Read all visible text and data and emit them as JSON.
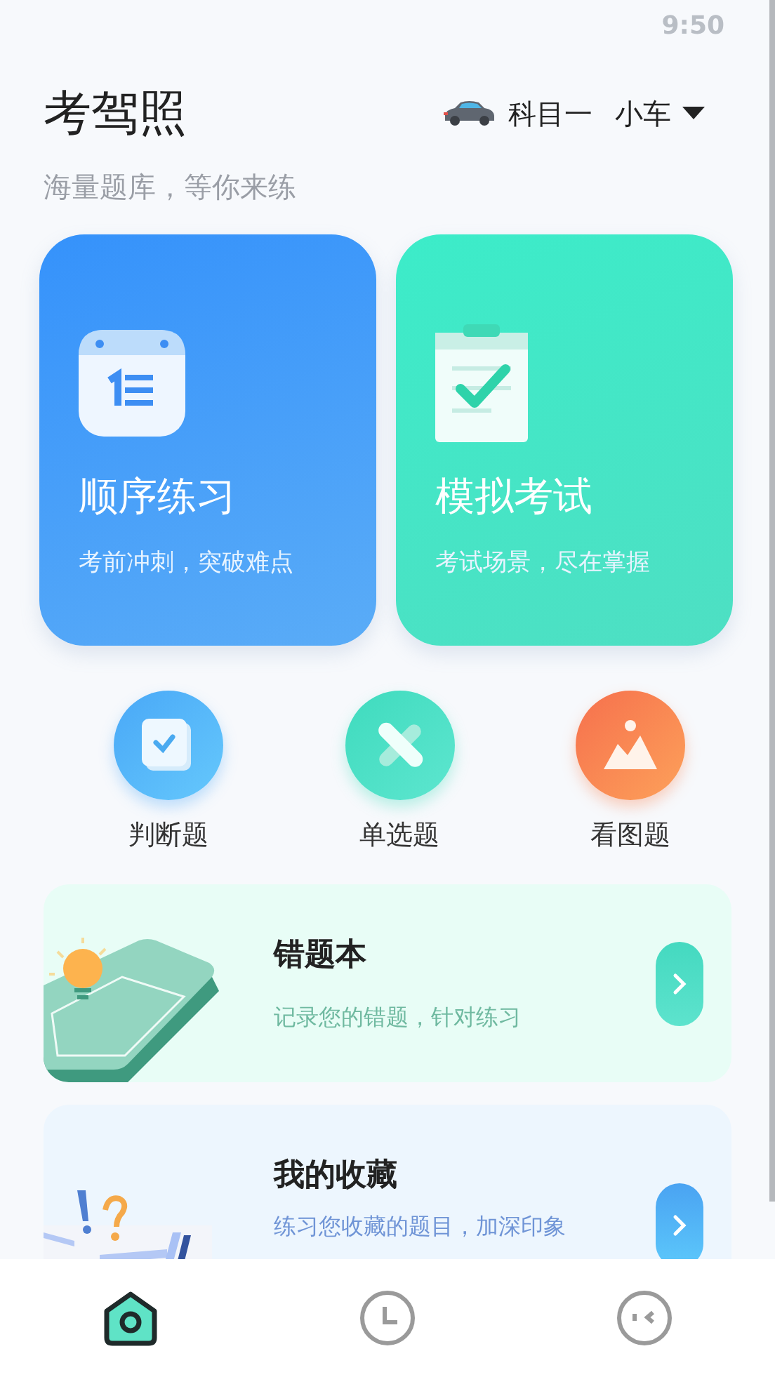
{
  "status_bar": {
    "time": "9:50"
  },
  "header": {
    "title": "考驾照",
    "subtitle": "海量题库，等你来练",
    "subject": "科目一",
    "vehicle": "小车"
  },
  "feature_cards": [
    {
      "kind": "sequential",
      "title": "顺序练习",
      "subtitle": "考前冲刺，突破难点"
    },
    {
      "kind": "mock_exam",
      "title": "模拟考试",
      "subtitle": "考试场景，尽在掌握"
    }
  ],
  "categories": [
    {
      "kind": "true_false",
      "label": "判断题"
    },
    {
      "kind": "single_choice",
      "label": "单选题"
    },
    {
      "kind": "image",
      "label": "看图题"
    }
  ],
  "list_cards": [
    {
      "kind": "mistakes",
      "title": "错题本",
      "subtitle": "记录您的错题，针对练习"
    },
    {
      "kind": "favorites",
      "title": "我的收藏",
      "subtitle": "练习您收藏的题目，加深印象"
    }
  ],
  "tab_bar": [
    {
      "kind": "home",
      "selected": true
    },
    {
      "kind": "history",
      "selected": false
    },
    {
      "kind": "profile",
      "selected": false
    }
  ]
}
